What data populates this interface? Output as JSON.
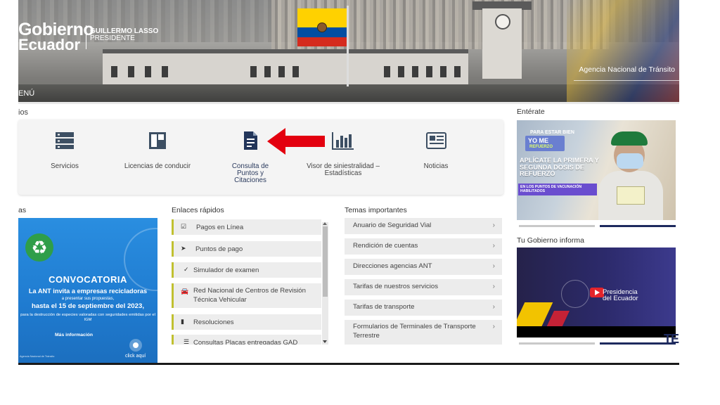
{
  "header": {
    "logo_line1": "Gobierno",
    "logo_line2": "Ecuador",
    "president_name": "GUILLERMO LASSO",
    "president_title": "PRESIDENTE",
    "agency": "Agencia Nacional de Tránsito",
    "menu_label": "ENÚ"
  },
  "services": {
    "section_title": "ios",
    "items": [
      {
        "label": "Servicios",
        "icon": "server-stack-icon"
      },
      {
        "label": "Licencias de conducir",
        "icon": "license-panel-icon"
      },
      {
        "label": "Consulta de Puntos y Citaciones",
        "icon": "document-icon"
      },
      {
        "label": "Visor de siniestralidad – Estadísticas",
        "icon": "bar-chart-icon"
      },
      {
        "label": "Noticias",
        "icon": "newspaper-icon"
      }
    ]
  },
  "news_section": {
    "title": "as",
    "convocatoria": {
      "heading": "CONVOCATORIA",
      "line1": "La ANT invita a empresas recicladoras",
      "line2": "a presentar sus propuestas,",
      "line3": "hasta el 15 de septiembre del 2023,",
      "line4": "para la destrucción de especies valoradas con seguridades emitidas por el IGM",
      "more": "Más información",
      "click": "click aquí",
      "footer": "Agencia Nacional de Tránsito"
    }
  },
  "quick_links": {
    "title": "Enlaces rápidos",
    "items": [
      {
        "label": "Pagos en Línea",
        "icon": "checkbox-icon"
      },
      {
        "label": "Puntos de pago",
        "icon": "location-arrow-icon"
      },
      {
        "label": "Simulador de examen",
        "icon": "check-icon"
      },
      {
        "label": "Red Nacional de Centros de Revisión Técnica Vehicular",
        "icon": "car-icon"
      },
      {
        "label": "Resoluciones",
        "icon": "book-icon"
      },
      {
        "label": "Consultas Placas entregadas GAD",
        "icon": "list-icon"
      }
    ]
  },
  "temas": {
    "title": "Temas importantes",
    "items": [
      "Anuario de Seguridad Vial",
      "Rendición de cuentas",
      "Direcciones agencias ANT",
      "Tarifas de nuestros servicios",
      "Tarifas de transporte",
      "Formularios de Terminales de Transporte Terrestre"
    ],
    "chevron": "›"
  },
  "sidebar": {
    "enterate_title": "Entérate",
    "vaccine_ad": {
      "kicker": "PARA ESTAR BIEN",
      "badge": "YO ME",
      "badge_sub": "REFUERZO",
      "headline": "APLÍCATE LA PRIMERA Y SEGUNDA DOSIS DE REFUERZO",
      "subline": "EN LOS PUNTOS DE VACUNACIÓN HABILITADOS"
    },
    "gobierno_title": "Tu Gobierno informa",
    "video": {
      "text_line1": "Presidencia",
      "text_line2": "del Ecuador"
    },
    "watermark": "TE"
  },
  "colors": {
    "accent_blue": "#1e2a5e",
    "arrow_red": "#e3000f",
    "link_border": "#c0c030"
  }
}
